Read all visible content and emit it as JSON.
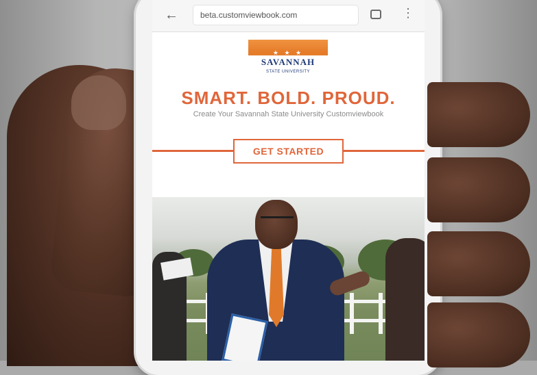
{
  "browser": {
    "url": "beta.customviewbook.com",
    "back_icon": "←",
    "menu_icon": "⋮",
    "icons": [
      "back-arrow-icon",
      "tabs-icon",
      "overflow-menu-icon"
    ]
  },
  "page": {
    "logo_word": "SAVANNAH",
    "logo_stars": "★ ★ ★",
    "logo_sub": "STATE UNIVERSITY",
    "headline": "SMART. BOLD. PROUD.",
    "subtext": "Create Your Savannah State University Customviewbook",
    "cta_label": "GET STARTED"
  },
  "colors": {
    "accent": "#e0663a",
    "logo_orange": "#e57c2a",
    "logo_navy": "#1f3a78",
    "skin": "#4a2c20"
  }
}
